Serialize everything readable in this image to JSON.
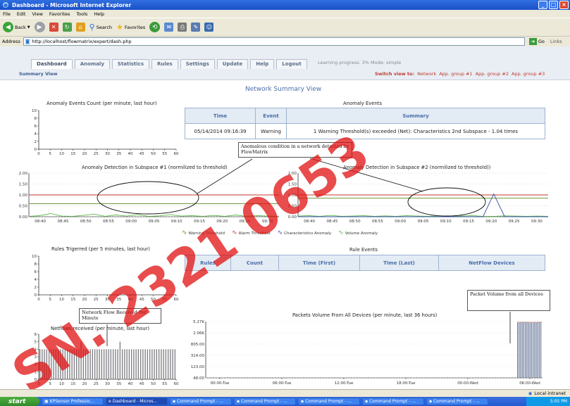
{
  "window": {
    "title": "Dashboard - Microsoft Internet Explorer",
    "buttons": [
      "_",
      "□",
      "×"
    ]
  },
  "menu": [
    "File",
    "Edit",
    "View",
    "Favorites",
    "Tools",
    "Help"
  ],
  "toolbar": {
    "back": "Back",
    "search": "Search",
    "favorites": "Favorites"
  },
  "address": {
    "label": "Address",
    "url": "http://localhost/flowmatrix/expert/dash.php",
    "go": "Go",
    "links": "Links"
  },
  "nav": {
    "tabs": [
      "Dashboard",
      "Anomaly",
      "Statistics",
      "Rules",
      "Settings",
      "Update",
      "Help",
      "Logout"
    ],
    "active_tab": "Dashboard",
    "learning": "Learning progress: 3%   Mode: simple",
    "summary_view": "Summary View",
    "switch_label": "Switch view to:",
    "switch_options": [
      "Network",
      "App. group #1",
      "App. group #2",
      "App. group #3"
    ]
  },
  "page_title": "Network Summary View",
  "anomaly_events": {
    "title": "Anomaly Events",
    "columns": [
      "Time",
      "Event",
      "Summary"
    ],
    "rows": [
      {
        "time": "05/14/2014  09:16:39",
        "event": "Warning",
        "summary": "1 Warning Threshold(s) exceeded (Net): Characteristics 2nd Subspace - 1.04 times"
      }
    ]
  },
  "rule_events": {
    "title": "Rule Events",
    "columns": [
      "Rules",
      "Count",
      "Time (First)",
      "Time (Last)",
      "NetFlow Devices"
    ]
  },
  "legend": [
    "Warning Threshold",
    "Alarm Threshold",
    "Characteristics Anomaly",
    "Volume Anomaly"
  ],
  "colors": {
    "warning": "#5a8a2a",
    "alarm": "#c0392b",
    "characteristics": "#3a4faa",
    "volume": "#5fb84a",
    "watermark": "#e01010"
  },
  "callouts": {
    "anomalous": "Anomalous condition in a network detected by FlowMatrix",
    "netflow": "Network Flow Received Per Minute",
    "packet": "Packet Volume from all Devices"
  },
  "watermark": "SN. 2321 0653",
  "chart_data": [
    {
      "type": "line",
      "title": "Anomaly Events Count (per minute, last hour)",
      "x": [
        0,
        5,
        10,
        15,
        20,
        25,
        30,
        35,
        40,
        45,
        50,
        55,
        60
      ],
      "ylim": [
        0,
        10
      ],
      "yticks": [
        0,
        2,
        4,
        6,
        8,
        10
      ],
      "series": []
    },
    {
      "type": "line",
      "title": "Anomaly Detection in Subspace #1 (normilized to threshold)",
      "xticks": [
        "08:40",
        "08:45",
        "08:50",
        "08:55",
        "09:00",
        "09:05",
        "09:10",
        "09:15",
        "09:20",
        "09:25",
        "09:30"
      ],
      "yticks": [
        "0.00",
        "0.50",
        "1.00",
        "1.50",
        "2.00"
      ],
      "ylim": [
        0,
        2
      ],
      "thresholds": {
        "warning": 0.6,
        "alarm": 1.0
      },
      "series": [
        {
          "values": [
            0.02,
            0.05,
            0.15,
            0.03,
            0.02,
            0.06,
            0.12,
            0.02,
            0.08,
            0.03,
            0.1,
            0.02,
            0.04,
            0.1,
            0.03,
            0.05,
            0.02,
            0.06,
            0.02,
            0.08,
            0.02,
            0.05,
            0.03,
            0.02
          ]
        }
      ]
    },
    {
      "type": "line",
      "title": "Anomaly Detection in Subspace #2 (normilized to threshold))",
      "xticks": [
        "08:40",
        "08:45",
        "08:50",
        "08:55",
        "09:00",
        "09:05",
        "09:10",
        "09:15",
        "09:20",
        "09:25",
        "09:30"
      ],
      "yticks": [
        "0.00",
        "0.50",
        "1.00",
        "1.50",
        "2.00"
      ],
      "ylim": [
        0,
        2
      ],
      "thresholds": {
        "warning": 0.85,
        "alarm": 1.0
      },
      "series": [
        {
          "name": "Volume Anomaly",
          "values": [
            0.03,
            0.05,
            0.02,
            0.06,
            0.02,
            0.03,
            0.05,
            0.02,
            0.04,
            0.02,
            0.05,
            0.03,
            0.02,
            0.04,
            0.02,
            0.03,
            0.05,
            0.02,
            0.02,
            0.04,
            0.03,
            0.02,
            0.03,
            0.02
          ]
        },
        {
          "name": "Characteristics Anomaly",
          "values": [
            0,
            0,
            0,
            0,
            0,
            0,
            0,
            0,
            0,
            0,
            0,
            0,
            0,
            0,
            0,
            0,
            0,
            0,
            1.04,
            0,
            0,
            0,
            0,
            0
          ]
        }
      ]
    },
    {
      "type": "line",
      "title": "Rules Trigerred (per 5 minutes, last hour)",
      "x": [
        0,
        5,
        10,
        15,
        20,
        25,
        30,
        35,
        40,
        45,
        50,
        55,
        60
      ],
      "ylim": [
        0,
        10
      ],
      "yticks": [
        0,
        2,
        4,
        6,
        8,
        10
      ],
      "series": []
    },
    {
      "type": "bar",
      "title": "Netflows received (per minute, last hour)",
      "x": [
        0,
        5,
        10,
        15,
        20,
        25,
        30,
        35,
        40,
        45,
        50,
        55,
        60
      ],
      "ylim": [
        0,
        6
      ],
      "yticks": [
        0,
        1,
        2,
        3,
        4,
        5,
        6
      ],
      "values": [
        4,
        4,
        4,
        4,
        4,
        4,
        4,
        4,
        4,
        4,
        4,
        4,
        4,
        4,
        4,
        4,
        4,
        4,
        5,
        4,
        4,
        4,
        4,
        4,
        4,
        4,
        4,
        4,
        4,
        4,
        4,
        4,
        4,
        4,
        4,
        5,
        4,
        4,
        4,
        4,
        4,
        4,
        4,
        4,
        4,
        4,
        4,
        4,
        4,
        4,
        4,
        4,
        4,
        4,
        4,
        4,
        4,
        4,
        4,
        4
      ]
    },
    {
      "type": "bar",
      "title": "Packets Volume From All Devices (per minute, last 36 hours)",
      "xticks": [
        "00:00-Tue",
        "06:00-Tue",
        "12:00-Tue",
        "18:00-Tue",
        "00:00-Wed",
        "06:00-Wed"
      ],
      "yticks": [
        "48.00",
        "123.00",
        "314.00",
        "805.00",
        "2.06K",
        "5.27K"
      ],
      "scale": "log",
      "values": [
        5000,
        5000,
        5000,
        5000,
        5000,
        5000,
        5000,
        5000,
        5000,
        5000,
        5000,
        5000,
        5000,
        5000,
        5000,
        5000
      ]
    }
  ],
  "status": {
    "zone": "Local intranet"
  },
  "taskbar": {
    "start": "start",
    "tasks": [
      "KPSensor Professio...",
      "Dashboard - Micros...",
      "Command Prompt - ...",
      "Command Prompt - ...",
      "Command Prompt - ...",
      "Command Prompt - ...",
      "Command Prompt - ..."
    ],
    "clock": "5:05 PM"
  }
}
